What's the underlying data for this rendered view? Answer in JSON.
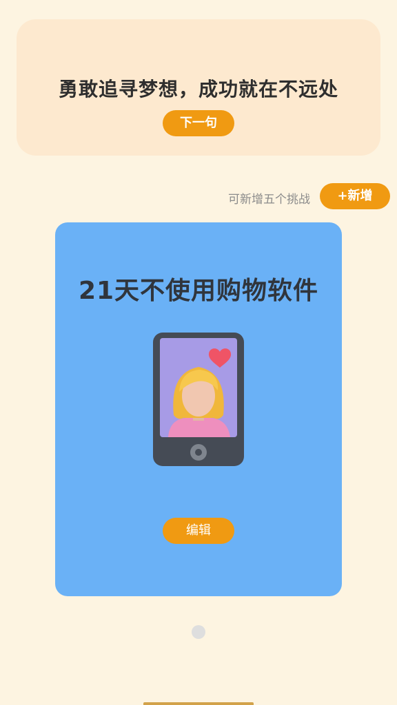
{
  "quote": {
    "text": "勇敢追寻梦想，成功就在不远处",
    "next_label": "下一句"
  },
  "challenge_header": {
    "hint": "可新增五个挑战",
    "add_label": "+新增"
  },
  "challenge_card": {
    "title": "21天不使用购物软件",
    "edit_label": "编辑",
    "illustration_icon": "phone-selfie-heart-icon",
    "background_color": "#6ab1f6"
  },
  "pagination": {
    "dots": 1,
    "active_index": 0
  },
  "colors": {
    "page_background": "#fdf4e1",
    "quote_card": "#fde9cf",
    "accent": "#f09a12"
  }
}
